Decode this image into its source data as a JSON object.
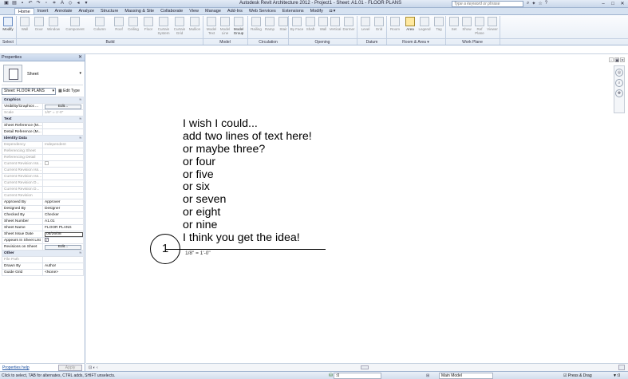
{
  "window": {
    "title": "Autodesk Revit Architecture 2012 -   Project1 - Sheet: A1.01 - FLOOR PLANS",
    "search_placeholder": "Type a keyword or phrase"
  },
  "ribbon_tabs": [
    "Home",
    "Insert",
    "Annotate",
    "Analyze",
    "Structure",
    "Massing & Site",
    "Collaborate",
    "View",
    "Manage",
    "Add-Ins",
    "Web Services",
    "Extensions",
    "Modify",
    "◘ ▾"
  ],
  "ribbon_buttons": {
    "modify": "Modify",
    "wall": "Wall",
    "door": "Door",
    "window": "Window",
    "component": "Component",
    "column": "Column",
    "roof": "Roof",
    "ceiling": "Ceiling",
    "floor": "Floor",
    "curtain_system": "Curtain System",
    "curtain_grid": "Curtain Grid",
    "mullion": "Mullion",
    "model_text": "Model Text",
    "model_line": "Model Line",
    "model_group": "Model Group",
    "railing": "Railing",
    "ramp": "Ramp",
    "stair": "Stair",
    "by_face": "By Face",
    "shaft": "Shaft",
    "wall_open": "Wall",
    "vertical": "Vertical",
    "dormer": "Dormer",
    "level": "Level",
    "grid": "Grid",
    "room": "Room",
    "area": "Area",
    "legend": "Legend",
    "tag": "Tag",
    "set": "Set",
    "show": "Show",
    "ref_plane": "Ref Plane",
    "viewer": "Viewer"
  },
  "ribbon_panels": {
    "select": "Select",
    "build": "Build",
    "model": "Model",
    "circulation": "Circulation",
    "opening": "Opening",
    "datum": "Datum",
    "room_area": "Room & Area ▾",
    "work_plane": "Work Plane"
  },
  "properties": {
    "header": "Properties",
    "type_name": "Sheet",
    "instance_selector": "Sheet: FLOOR PLANS",
    "edit_type": "Edit Type",
    "help_link": "Properties help",
    "apply_button": "Apply",
    "groups": {
      "graphics": "Graphics",
      "text": "Text",
      "identity": "Identity Data",
      "other": "Other"
    },
    "toggle": "≈",
    "edit_label": "Edit...",
    "graphics_rows": [
      {
        "name": "Visibility/Graphics ..."
      },
      {
        "name": "Scale",
        "value": "1/8\" = 1'-0\""
      }
    ],
    "text_rows": [
      {
        "name": "Sheet Reference (M..."
      },
      {
        "name": "Detail Reference (M..."
      }
    ],
    "identity_rows": [
      {
        "name": "Dependency",
        "value": "Independent"
      },
      {
        "name": "Referencing Sheet",
        "value": ""
      },
      {
        "name": "Referencing Detail",
        "value": ""
      },
      {
        "name": "Current Revision Iss...",
        "value": ""
      },
      {
        "name": "Current Revision Iss...",
        "value": ""
      },
      {
        "name": "Current Revision Iss...",
        "value": ""
      },
      {
        "name": "Current Revision D...",
        "value": ""
      },
      {
        "name": "Current Revision D...",
        "value": ""
      },
      {
        "name": "Current Revision",
        "value": ""
      },
      {
        "name": "Approved By",
        "value": "Approver"
      },
      {
        "name": "Designed By",
        "value": "Designer"
      },
      {
        "name": "Checked By",
        "value": "Checker"
      },
      {
        "name": "Sheet Number",
        "value": "A1.01"
      },
      {
        "name": "Sheet Name",
        "value": "FLOOR PLANS"
      },
      {
        "name": "Sheet Issue Date",
        "value": "08/26/08"
      },
      {
        "name": "Appears In Sheet List",
        "value": "✓"
      },
      {
        "name": "Revisions on Sheet",
        "value": ""
      }
    ],
    "other_rows": [
      {
        "name": "File Path",
        "value": ""
      },
      {
        "name": "Drawn By",
        "value": "Author"
      },
      {
        "name": "Guide Grid",
        "value": "<None>"
      }
    ]
  },
  "sheet": {
    "text_lines": [
      "I wish I could...",
      "add two lines of text here!",
      "or maybe three?",
      "or four",
      "or five",
      "or six",
      "or seven",
      "or eight",
      "or nine",
      "I think you get the idea!"
    ],
    "view_number": "1",
    "view_scale": "1/8\" = 1'-0\""
  },
  "view_control_bar": {
    "scale_glyph": "⊡ ◐ ‹"
  },
  "status_bar": {
    "message": "Click to select, TAB for alternates, CTRL adds, SHIFT unselects.",
    "worksets_value": ":0",
    "design_option": "Main Model",
    "press_drag": "Press & Drag",
    "filter_count": "▼:0"
  }
}
